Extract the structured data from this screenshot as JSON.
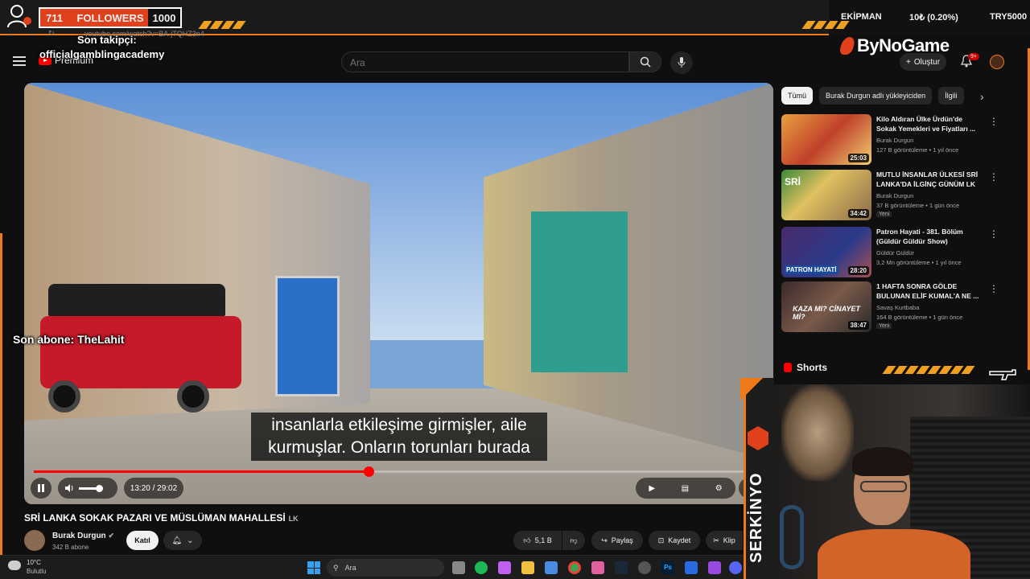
{
  "overlay": {
    "followers_count": "711",
    "followers_label": "FOLLOWERS",
    "followers_goal": "1000",
    "last_follower_label": "Son takipçi:",
    "last_follower_name": "officialgamblingacademy",
    "last_sub_label": "Son abone: TheLahit",
    "team": "EKİPMAN",
    "rate": "10₺ (0.20%)",
    "code": "TRY5000",
    "sponsor": "ByNoGame",
    "streamer": "SERKİNYO"
  },
  "browser": {
    "url": "youtube.com/watch?v=BA-jTQHZ3n4"
  },
  "header": {
    "logo_text": "Premium",
    "search_placeholder": "Ara",
    "create_label": "Oluştur",
    "notif_badge": "9+"
  },
  "video": {
    "subtitle_line1": "insanlarla etkileşime girmişler, aile",
    "subtitle_line2": "kurmuşlar. Onların torunları burada",
    "time": "13:20 / 29:02",
    "progress": 0.459,
    "title": "SRİ LANKA SOKAK PAZARI VE MÜSLÜMAN MAHALLESİ",
    "title_suffix": "LK",
    "channel": "Burak Durgun",
    "subscribers": "342 B abone",
    "join_label": "Katıl",
    "likes": "5,1 B",
    "share_label": "Paylaş",
    "save_label": "Kaydet",
    "clip_label": "Klip"
  },
  "sidebar": {
    "chips": [
      "Tümü",
      "Burak Durgun adlı yükleyiciden",
      "İlgili"
    ],
    "related": [
      {
        "title": "Kilo Aldıran Ülke Ürdün'de Sokak Yemekleri ve Fiyatları ...",
        "channel": "Burak Durgun",
        "meta": "127 B görüntüleme • 1 yıl önce",
        "duration": "25:03",
        "badge": ""
      },
      {
        "title": "MUTLU İNSANLAR ÜLKESİ SRİ LANKA'DA İLGİNÇ GÜNÜM LK",
        "channel": "Burak Durgun",
        "meta": "37 B görüntüleme • 1 gün önce",
        "duration": "34:42",
        "badge": "Yeni"
      },
      {
        "title": "Patron Hayati - 381. Bölüm (Güldür Güldür Show)",
        "channel": "Güldür Güldür",
        "meta": "3,2 Mn görüntüleme • 1 yıl önce",
        "duration": "28:20",
        "badge": ""
      },
      {
        "title": "1 HAFTA SONRA GÖLDE BULUNAN ELİF KUMAL'A NE ...",
        "channel": "Savaş Kurtbaba",
        "meta": "164 B görüntüleme • 1 gün önce",
        "duration": "38:47",
        "badge": "Yeni"
      }
    ],
    "thumb_texts": [
      "",
      "SRİ",
      "PATRON HAYATİ",
      "KAZA MI? CİNAYET Mİ?"
    ],
    "shorts_label": "Shorts"
  },
  "taskbar": {
    "temp": "10°C",
    "condition": "Bulutlu",
    "search_label": "Ara"
  },
  "colors": {
    "accent_orange": "#f07a1a",
    "youtube_red": "#ff0000"
  }
}
